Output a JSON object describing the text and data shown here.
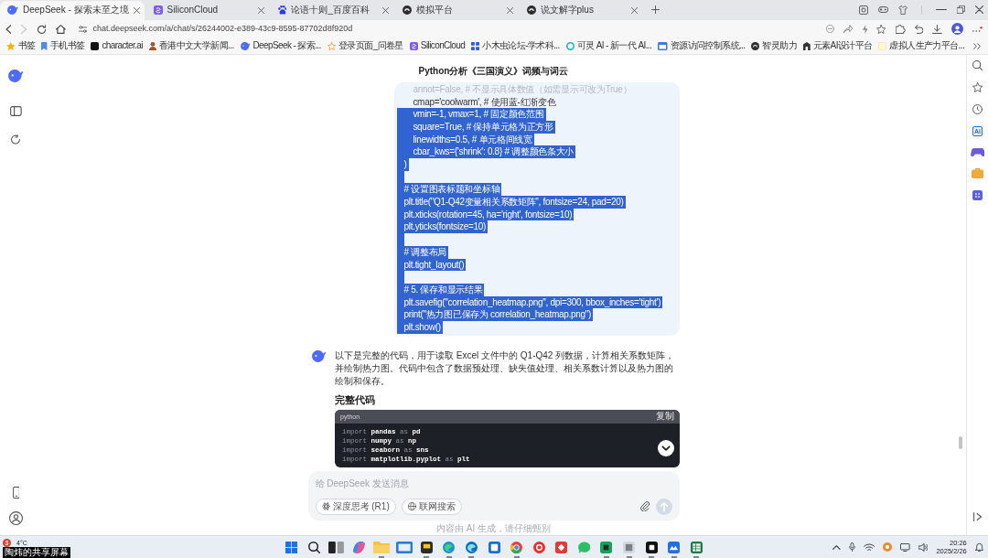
{
  "tabs": [
    {
      "title": "DeepSeek - 探索未至之境",
      "selected": true
    },
    {
      "title": "SiliconCloud",
      "selected": false
    },
    {
      "title": "论语十则_百度百科",
      "selected": false
    },
    {
      "title": "模拟平台",
      "selected": false
    },
    {
      "title": "说文解字plus",
      "selected": false
    }
  ],
  "navigation": {
    "forward_disabled": true,
    "url": "chat.deepseek.com/a/chat/s/26244002-e389-43c9-8595-87702d8f920d"
  },
  "bookmarks": [
    {
      "label": "书签"
    },
    {
      "label": "手机书签"
    },
    {
      "label": "character.ai"
    },
    {
      "label": "香港中文大学新闻..."
    },
    {
      "label": "DeepSeek - 探索..."
    },
    {
      "label": "登录页面_问卷星"
    },
    {
      "label": "SiliconCloud"
    },
    {
      "label": "小木虫论坛-学术科..."
    },
    {
      "label": "可灵 AI - 新一代 AI..."
    },
    {
      "label": "资源访问控制系统..."
    },
    {
      "label": "智灵助力"
    },
    {
      "label": "元素AI设计平台"
    },
    {
      "label": "虚拟人生产力平台..."
    }
  ],
  "chat": {
    "title": "Python分析《三国演义》词频与词云",
    "user_message": {
      "lines": [
        {
          "kind": "faded",
          "text": "    annot=False, # 不显示具体数值（如需显示可改为True）",
          "selected": false
        },
        {
          "kind": "code",
          "text": "    cmap='coolwarm', # 使用蓝-红渐变色",
          "selected": false
        },
        {
          "kind": "code",
          "text": "    vmin=-1, vmax=1, # 固定颜色范围",
          "selected": true
        },
        {
          "kind": "code",
          "text": "    square=True, # 保持单元格为正方形",
          "selected": true
        },
        {
          "kind": "code",
          "text": "    linewidths=0.5, # 单元格间线宽",
          "selected": true
        },
        {
          "kind": "code",
          "text": "    cbar_kws={'shrink': 0.8} # 调整颜色条大小",
          "selected": true
        },
        {
          "kind": "code",
          "text": ")",
          "selected": true
        },
        {
          "kind": "blank",
          "selected": true
        },
        {
          "kind": "code",
          "text": "# 设置图表标题和坐标轴",
          "selected": true
        },
        {
          "kind": "code",
          "text": "plt.title(\"Q1-Q42变量相关系数矩阵\", fontsize=24, pad=20)",
          "selected": true
        },
        {
          "kind": "code",
          "text": "plt.xticks(rotation=45, ha='right', fontsize=10)",
          "selected": true
        },
        {
          "kind": "code",
          "text": "plt.yticks(fontsize=10)",
          "selected": true
        },
        {
          "kind": "blank",
          "selected": true
        },
        {
          "kind": "code",
          "text": "# 调整布局",
          "selected": true
        },
        {
          "kind": "code",
          "text": "plt.tight_layout()",
          "selected": true
        },
        {
          "kind": "blank",
          "selected": true
        },
        {
          "kind": "code",
          "text": "# 5. 保存和显示结果",
          "selected": true
        },
        {
          "kind": "code",
          "text": "plt.savefig(\"correlation_heatmap.png\", dpi=300, bbox_inches='tight')",
          "selected": true
        },
        {
          "kind": "code",
          "text": "print(\"热力图已保存为 correlation_heatmap.png\")",
          "selected": true
        },
        {
          "kind": "code",
          "text": "plt.show()",
          "selected": true
        }
      ]
    },
    "reply": {
      "text": "以下是完整的代码，用于读取 Excel 文件中的 Q1-Q42 列数据，计算相关系数矩阵，并绘制热力图。代码中包含了数据预处理、缺失值处理、相关系数计算以及热力图的绘制和保存。",
      "heading": "完整代码",
      "code": {
        "language": "python",
        "copy_label": "复制",
        "lines": [
          "import **pandas** as **pd**",
          "import **numpy** as **np**",
          "import **seaborn** as **sns**",
          "import **matplotlib.pyplot** as **plt**"
        ]
      }
    },
    "composer": {
      "placeholder": "给 DeepSeek 发送消息",
      "toggles": [
        {
          "label": "深度思考 (R1)",
          "selected": false
        },
        {
          "label": "联网搜索",
          "selected": false
        }
      ],
      "send": {
        "disabled": true
      }
    },
    "disclaimer": "内容由 AI 生成，请仔细甄别"
  },
  "browser_sidebar": {
    "ai_label": "Ai"
  },
  "taskbar": {
    "weather": {
      "alert_count": "3",
      "temperature": "4°C"
    },
    "apps": [
      {
        "running": false
      },
      {
        "running": false
      },
      {
        "running": false
      },
      {
        "running": false
      },
      {
        "running": true
      },
      {
        "running": false
      },
      {
        "running": true
      },
      {
        "running": true
      },
      {
        "running": true
      },
      {
        "running": false
      },
      {
        "running": true
      },
      {
        "running": false
      },
      {
        "running": false
      },
      {
        "running": false
      },
      {
        "running": true
      },
      {
        "running": true
      },
      {
        "running": true
      },
      {
        "running": true
      },
      {
        "running": true
      }
    ],
    "time": "20:26",
    "date": "2025/2/26"
  },
  "screen_share_label": "陶炜的共享屏幕"
}
